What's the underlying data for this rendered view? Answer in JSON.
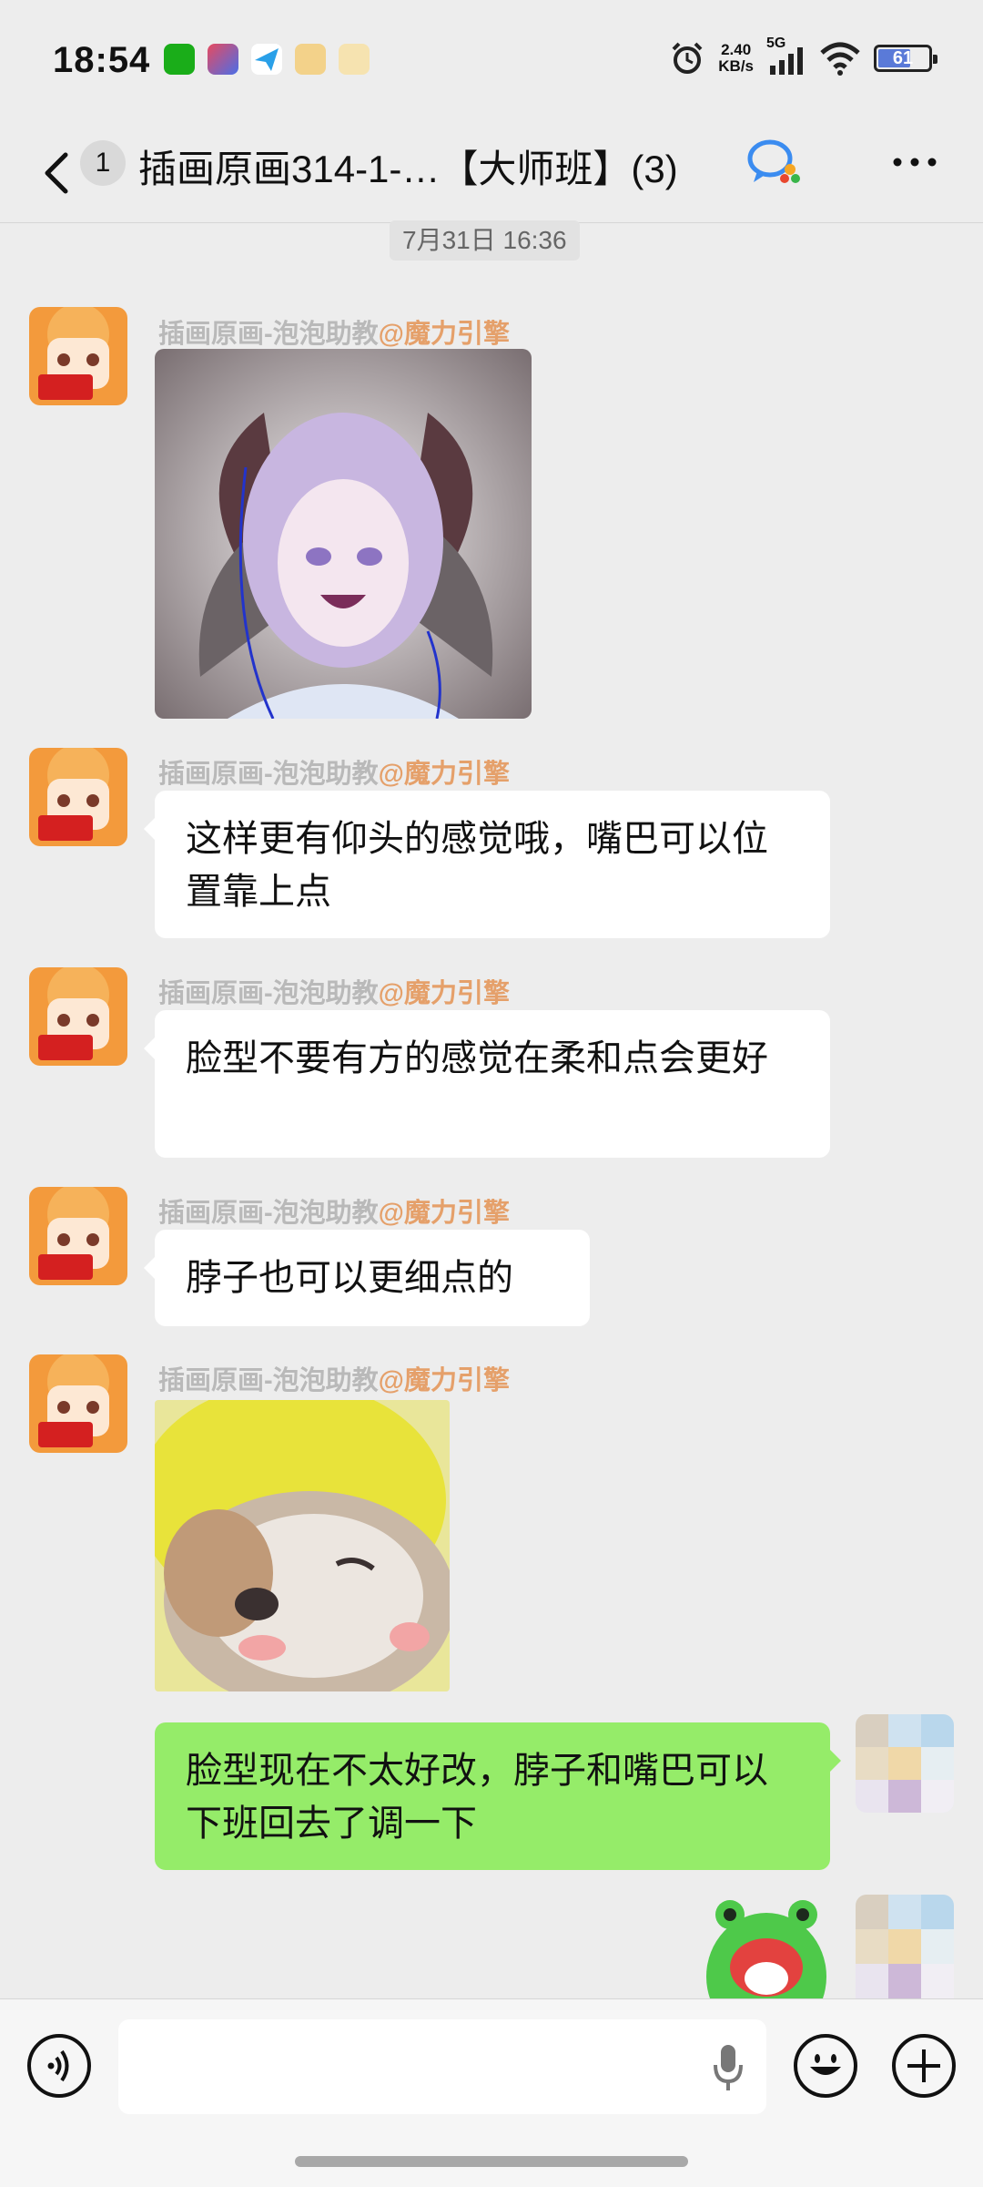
{
  "status": {
    "time": "18:54",
    "net_speed_value": "2.40",
    "net_speed_unit": "KB/s",
    "network": "5G",
    "battery": "61"
  },
  "nav": {
    "unread_count": "1",
    "title": "插画原画314-1-…【大师班】(3)"
  },
  "timestamp": "7月31日 16:36",
  "sender": {
    "name": "插画原画-泡泡助教",
    "mention": "@魔力引擎"
  },
  "messages": [
    {
      "text": ""
    },
    {
      "text": "这样更有仰头的感觉哦，嘴巴可以位置靠上点"
    },
    {
      "text": "脸型不要有方的感觉在柔和点会更好"
    },
    {
      "text": "脖子也可以更细点的"
    },
    {
      "text": ""
    },
    {
      "text": "脸型现在不太好改，脖子和嘴巴可以下班回去了调一下"
    }
  ],
  "colors": {
    "background": "#ededed",
    "my_bubble": "#95ec69",
    "other_bubble": "#ffffff",
    "mention": "#e5a06a"
  }
}
